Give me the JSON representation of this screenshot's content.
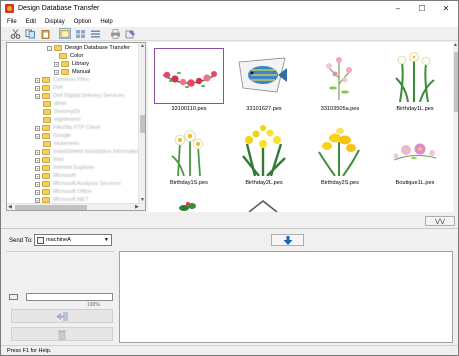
{
  "window": {
    "title": "Design Database Transfer"
  },
  "menu": [
    "File",
    "Edit",
    "Display",
    "Option",
    "Help"
  ],
  "toolbar": {
    "icons": [
      "cut-icon",
      "copy-icon",
      "paste-icon",
      "large-thumbnail-icon",
      "medium-thumbnail-icon",
      "small-thumbnail-icon",
      "print-icon",
      "properties-icon"
    ]
  },
  "tree": {
    "items": [
      {
        "label": "Design Database Transfer",
        "blurred": false
      },
      {
        "label": "Color",
        "blurred": false
      },
      {
        "label": "Library",
        "blurred": false
      },
      {
        "label": "Manual",
        "blurred": false
      },
      {
        "label": "Common Files",
        "blurred": true
      },
      {
        "label": "Dell",
        "blurred": true
      },
      {
        "label": "Dell Digital Delivery Services",
        "blurred": true
      },
      {
        "label": "dtnet",
        "blurred": true
      },
      {
        "label": "DummyDir",
        "blurred": true
      },
      {
        "label": "eightteenV",
        "blurred": true
      },
      {
        "label": "FileZilla FTP Client",
        "blurred": true
      },
      {
        "label": "Google",
        "blurred": true
      },
      {
        "label": "Hubeneric",
        "blurred": true
      },
      {
        "label": "InstallShield Installation Information",
        "blurred": true
      },
      {
        "label": "Intel",
        "blurred": true
      },
      {
        "label": "Internet Explorer",
        "blurred": true
      },
      {
        "label": "Microsoft",
        "blurred": true
      },
      {
        "label": "Microsoft Analysis Services",
        "blurred": true
      },
      {
        "label": "Microsoft Office",
        "blurred": true
      },
      {
        "label": "Microsoft.NET",
        "blurred": true
      }
    ]
  },
  "thumbnails": [
    {
      "file": "33100110.pes",
      "selected": true,
      "art": "rose-garland"
    },
    {
      "file": "33101627.pes",
      "selected": false,
      "art": "fish"
    },
    {
      "file": "33103505a.pes",
      "selected": false,
      "art": "pink-flowers"
    },
    {
      "file": "Birthday1L.pes",
      "selected": false,
      "art": "white-lilies"
    },
    {
      "file": "Birthday1S.pes",
      "selected": false,
      "art": "daffodils-small"
    },
    {
      "file": "Birthday2L.pes",
      "selected": false,
      "art": "yellow-bouquet"
    },
    {
      "file": "Birthday2S.pes",
      "selected": false,
      "art": "yellow-freesia"
    },
    {
      "file": "Boutique1L.pes",
      "selected": false,
      "art": "pink-blossom"
    }
  ],
  "colors": {
    "selection": "#8b4fa8",
    "transfer_arrow": "#1565c0",
    "folder": "#f4cf5e"
  },
  "send": {
    "label": "Send To:",
    "machine": "machineA",
    "capacity_value": "100%"
  },
  "status": {
    "text": "Press F1 for Help."
  }
}
